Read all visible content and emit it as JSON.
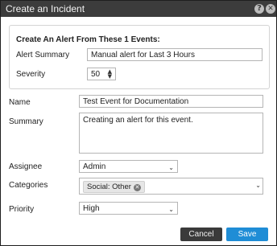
{
  "dialog": {
    "title": "Create an Incident",
    "help_icon": "?",
    "close_icon": "✕"
  },
  "panel": {
    "heading": "Create An Alert From These 1 Events:",
    "alert_summary_label": "Alert Summary",
    "alert_summary_value": "Manual alert for Last 3 Hours",
    "severity_label": "Severity",
    "severity_value": "50"
  },
  "form": {
    "name_label": "Name",
    "name_value": "Test Event for Documentation",
    "summary_label": "Summary",
    "summary_value": "Creating an alert for this event.",
    "assignee_label": "Assignee",
    "assignee_value": "Admin",
    "categories_label": "Categories",
    "categories_tags": [
      "Social: Other"
    ],
    "priority_label": "Priority",
    "priority_value": "High"
  },
  "footer": {
    "cancel_label": "Cancel",
    "save_label": "Save"
  },
  "colors": {
    "titlebar": "#3c3c3c",
    "cancel_button": "#3a3a3a",
    "save_button": "#1f8dd6"
  }
}
